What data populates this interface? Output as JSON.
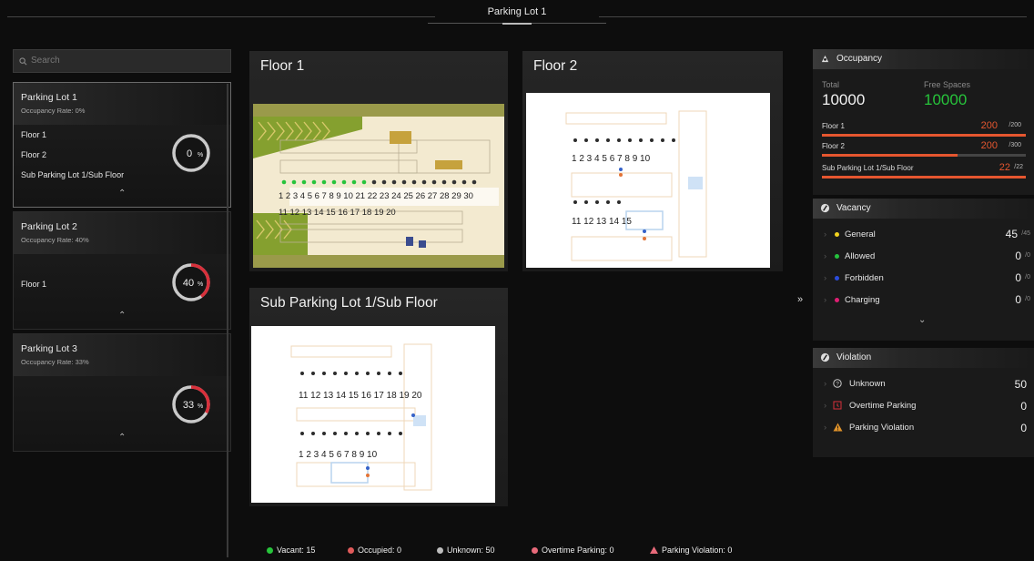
{
  "app": {
    "title": "Parking Lot 1"
  },
  "search": {
    "placeholder": "Search"
  },
  "lots": [
    {
      "name": "Parking Lot 1",
      "rate_label": "Occupancy Rate: 0%",
      "floors": [
        "Floor 1",
        "Floor 2",
        "Sub Parking Lot 1/Sub Floor"
      ],
      "ring_text": "0",
      "percent": 0
    },
    {
      "name": "Parking Lot 2",
      "rate_label": "Occupancy Rate: 40%",
      "floors": [
        "Floor 1"
      ],
      "ring_text": "40",
      "percent": 40
    },
    {
      "name": "Parking Lot 3",
      "rate_label": "Occupancy Rate: 33%",
      "floors": [],
      "ring_text": "33",
      "percent": 33
    }
  ],
  "maps": [
    {
      "title": "Floor 1",
      "row1": "1 2 3 4 5 6 7 8 9 10 21 22 23 24 25 26 27 28 29 30",
      "row2": "11 12 13 14 15 16 17 18 19 20"
    },
    {
      "title": "Floor 2",
      "row1": "1  2  3  4  5  6  7  8  9  10",
      "row2": "11 12 13 14 15"
    },
    {
      "title": "Sub Parking Lot 1/Sub Floor",
      "row1": "11 12 13 14 15 16 17 18 19 20",
      "row2": "1  2  3  4  5  6  7  8  9  10"
    }
  ],
  "occupancy": {
    "title": "Occupancy",
    "total_label": "Total",
    "total_value": "10000",
    "free_label": "Free Spaces",
    "free_value": "10000",
    "floors": [
      {
        "name": "Floor 1",
        "value": "200",
        "max": "/200",
        "fill": 1.0
      },
      {
        "name": "Floor 2",
        "value": "200",
        "max": "/300",
        "fill": 0.667
      },
      {
        "name": "Sub Parking Lot 1/Sub Floor",
        "value": "22",
        "max": "/22",
        "fill": 1.0
      }
    ]
  },
  "vacancy": {
    "title": "Vacancy",
    "items": [
      {
        "name": "General",
        "value": "45",
        "max": "/45",
        "color": "#f2d21e"
      },
      {
        "name": "Allowed",
        "value": "0",
        "max": "/0",
        "color": "#25c23d"
      },
      {
        "name": "Forbidden",
        "value": "0",
        "max": "/0",
        "color": "#2b4cdc"
      },
      {
        "name": "Charging",
        "value": "0",
        "max": "/0",
        "color": "#e01e73"
      }
    ]
  },
  "violation": {
    "title": "Violation",
    "items": [
      {
        "name": "Unknown",
        "value": "50",
        "icon": "unknown-icon"
      },
      {
        "name": "Overtime Parking",
        "value": "0",
        "icon": "clock-alert-icon"
      },
      {
        "name": "Parking Violation",
        "value": "0",
        "icon": "warning-icon"
      }
    ]
  },
  "legend": {
    "vacant": "Vacant:  15",
    "occupied": "Occupied:  0",
    "unknown": "Unknown:  50",
    "overtime": "Overtime Parking:  0",
    "violation": "Parking Violation:  0"
  },
  "colors": {
    "accent": "#e5562f",
    "free": "#27c43b",
    "ring": "#d8303b"
  }
}
